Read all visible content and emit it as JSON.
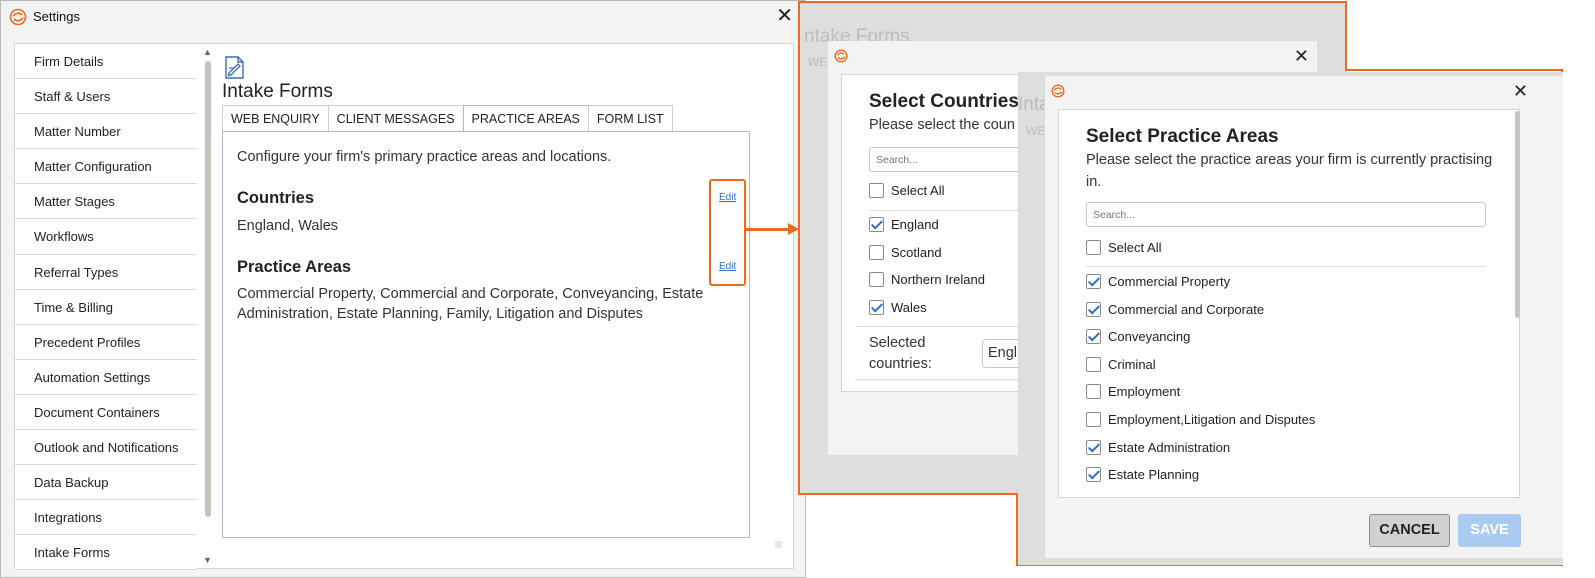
{
  "settings": {
    "title": "Settings",
    "nav": [
      "Firm Details",
      "Staff & Users",
      "Matter Number",
      "Matter Configuration",
      "Matter Stages",
      "Workflows",
      "Referral Types",
      "Time & Billing",
      "Precedent Profiles",
      "Automation Settings",
      "Document Containers",
      "Outlook and Notifications",
      "Data Backup",
      "Integrations",
      "Intake Forms"
    ],
    "active_nav": "Intake Forms",
    "page_title": "Intake Forms",
    "tabs": [
      "WEB ENQUIRY",
      "CLIENT MESSAGES",
      "PRACTICE AREAS",
      "FORM LIST"
    ],
    "active_tab": "PRACTICE AREAS",
    "intro": "Configure your firm's primary practice areas and locations.",
    "countries_heading": "Countries",
    "countries_value": "England, Wales",
    "practice_heading": "Practice Areas",
    "practice_value": "Commercial Property, Commercial and Corporate, Conveyancing, Estate Administration, Estate Planning, Family, Litigation and Disputes",
    "edit_label": "Edit"
  },
  "countries_modal": {
    "title": "Select Countries",
    "subtitle": "Please select the coun",
    "search_placeholder": "Search...",
    "select_all": "Select All",
    "items": [
      {
        "label": "England",
        "checked": true
      },
      {
        "label": "Scotland",
        "checked": false
      },
      {
        "label": "Northern Ireland",
        "checked": false
      },
      {
        "label": "Wales",
        "checked": true
      }
    ],
    "selected_label": "Selected countries:",
    "selected_value": "Engl",
    "bg_title": "ntake Forms",
    "bg_tab": "WE"
  },
  "practice_modal": {
    "title": "Select Practice Areas",
    "subtitle": "Please select the practice areas your firm is currently practising in.",
    "search_placeholder": "Search...",
    "select_all": "Select All",
    "items": [
      {
        "label": "Commercial Property",
        "checked": true
      },
      {
        "label": "Commercial and Corporate",
        "checked": true
      },
      {
        "label": "Conveyancing",
        "checked": true
      },
      {
        "label": "Criminal",
        "checked": false
      },
      {
        "label": "Employment",
        "checked": false
      },
      {
        "label": "Employment,Litigation and Disputes",
        "checked": false
      },
      {
        "label": "Estate Administration",
        "checked": true
      },
      {
        "label": "Estate Planning",
        "checked": true
      }
    ],
    "cancel_label": "CANCEL",
    "save_label": "SAVE",
    "bg_title": "Inta",
    "bg_tab": "WE"
  },
  "colors": {
    "accent_orange": "#ee6a1f",
    "link_blue": "#2f6fc8",
    "save_disabled": "#a9cbf1"
  },
  "icons": [
    "app-logo-icon",
    "close-icon",
    "document-edit-icon",
    "checkmark-icon"
  ]
}
